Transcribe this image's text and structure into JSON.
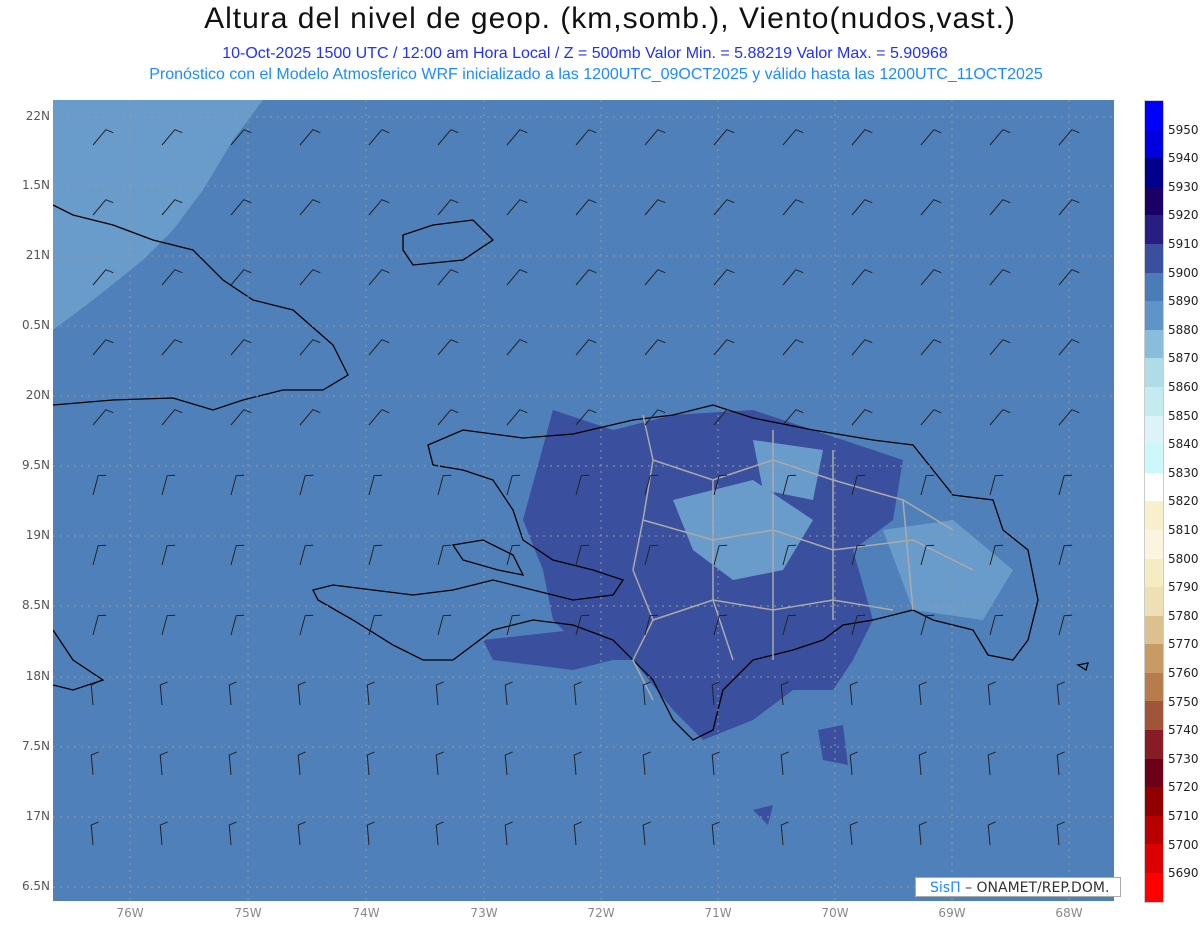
{
  "title": "Altura del nivel de geop. (km,somb.), Viento(nudos,vast.)",
  "subtitle": "10-Oct-2025  1500 UTC / 12:00 am Hora Local / Z = 500mb    Valor Min. = 5.88219   Valor Max. = 5.90968",
  "info": "Pronóstico con el Modelo Atmosferico WRF inicializado a las 1200UTC_09OCT2025 y válido hasta las  1200UTC_11OCT2025",
  "lat_labels": [
    "22N",
    "1.5N",
    "21N",
    "0.5N",
    "20N",
    "9.5N",
    "19N",
    "8.5N",
    "18N",
    "7.5N",
    "17N",
    "6.5N"
  ],
  "lon_labels": [
    "76W",
    "75W",
    "74W",
    "73W",
    "72W",
    "71W",
    "70W",
    "69W",
    "68W"
  ],
  "colorbar": {
    "labels": [
      "5950",
      "5940",
      "5930",
      "5920",
      "5910",
      "5900",
      "5890",
      "5880",
      "5870",
      "5860",
      "5850",
      "5840",
      "5830",
      "5820",
      "5810",
      "5800",
      "5790",
      "5780",
      "5770",
      "5760",
      "5750",
      "5740",
      "5730",
      "5720",
      "5710",
      "5700",
      "5690"
    ],
    "colors": [
      "#0000ff",
      "#0000e0",
      "#00008c",
      "#1a0066",
      "#281e82",
      "#3a509e",
      "#4a7cb8",
      "#5e94c8",
      "#8abcdc",
      "#b0dce8",
      "#c4ecf0",
      "#dcf4f8",
      "#ccf8fc",
      "#ffffff",
      "#f8f0cc",
      "#faf4e0",
      "#f6ecc4",
      "#eee0b4",
      "#dcc090",
      "#c89a64",
      "#b87c4c",
      "#a05438",
      "#881c24",
      "#6c0018",
      "#900000",
      "#b80000",
      "#dc0000",
      "#ff0000"
    ]
  },
  "logo": {
    "brand": "SisΠ",
    "org": "– ONAMET/REP.DOM."
  },
  "colors": {
    "field": "#4f80ba",
    "light": "#6a9ccb",
    "dark": "#3a509e"
  }
}
